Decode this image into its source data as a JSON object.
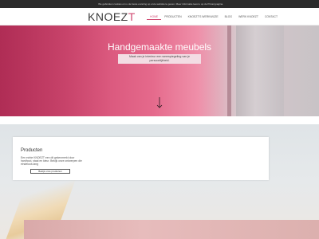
{
  "cookie_bar": {
    "text": "We gebruiken cookies om u de beste ervaring op onze website te geven. Meer informatie leest u op de Privacypagina."
  },
  "header": {
    "logo_main": "KNOEZ",
    "logo_accent": "T",
    "nav": [
      {
        "label": "Home",
        "active": true
      },
      {
        "label": "Producten",
        "active": false
      },
      {
        "label": "Knoezt's werkwijze",
        "active": false
      },
      {
        "label": "Blog",
        "active": false
      },
      {
        "label": "Werk Knoezt",
        "active": false
      },
      {
        "label": "Contact",
        "active": false
      }
    ]
  },
  "hero": {
    "title": "Handgemaakte meubels",
    "subtitle": "Maak van je interieur een weerspiegeling van je persoonlijkheid.",
    "arrow_icon": "arrow-down-icon"
  },
  "products": {
    "title": "Producten",
    "text": "Een echte KNOEZT een dit gekenmerkt door hardhout, staal en kleur. Bekijk onze ontwerpen die eindeloos lang",
    "button_label": "Bekijk onze producten"
  },
  "colors": {
    "accent": "#d04a72",
    "hero_pink": "#d24a72",
    "dark_bar": "#2b2b2b"
  }
}
